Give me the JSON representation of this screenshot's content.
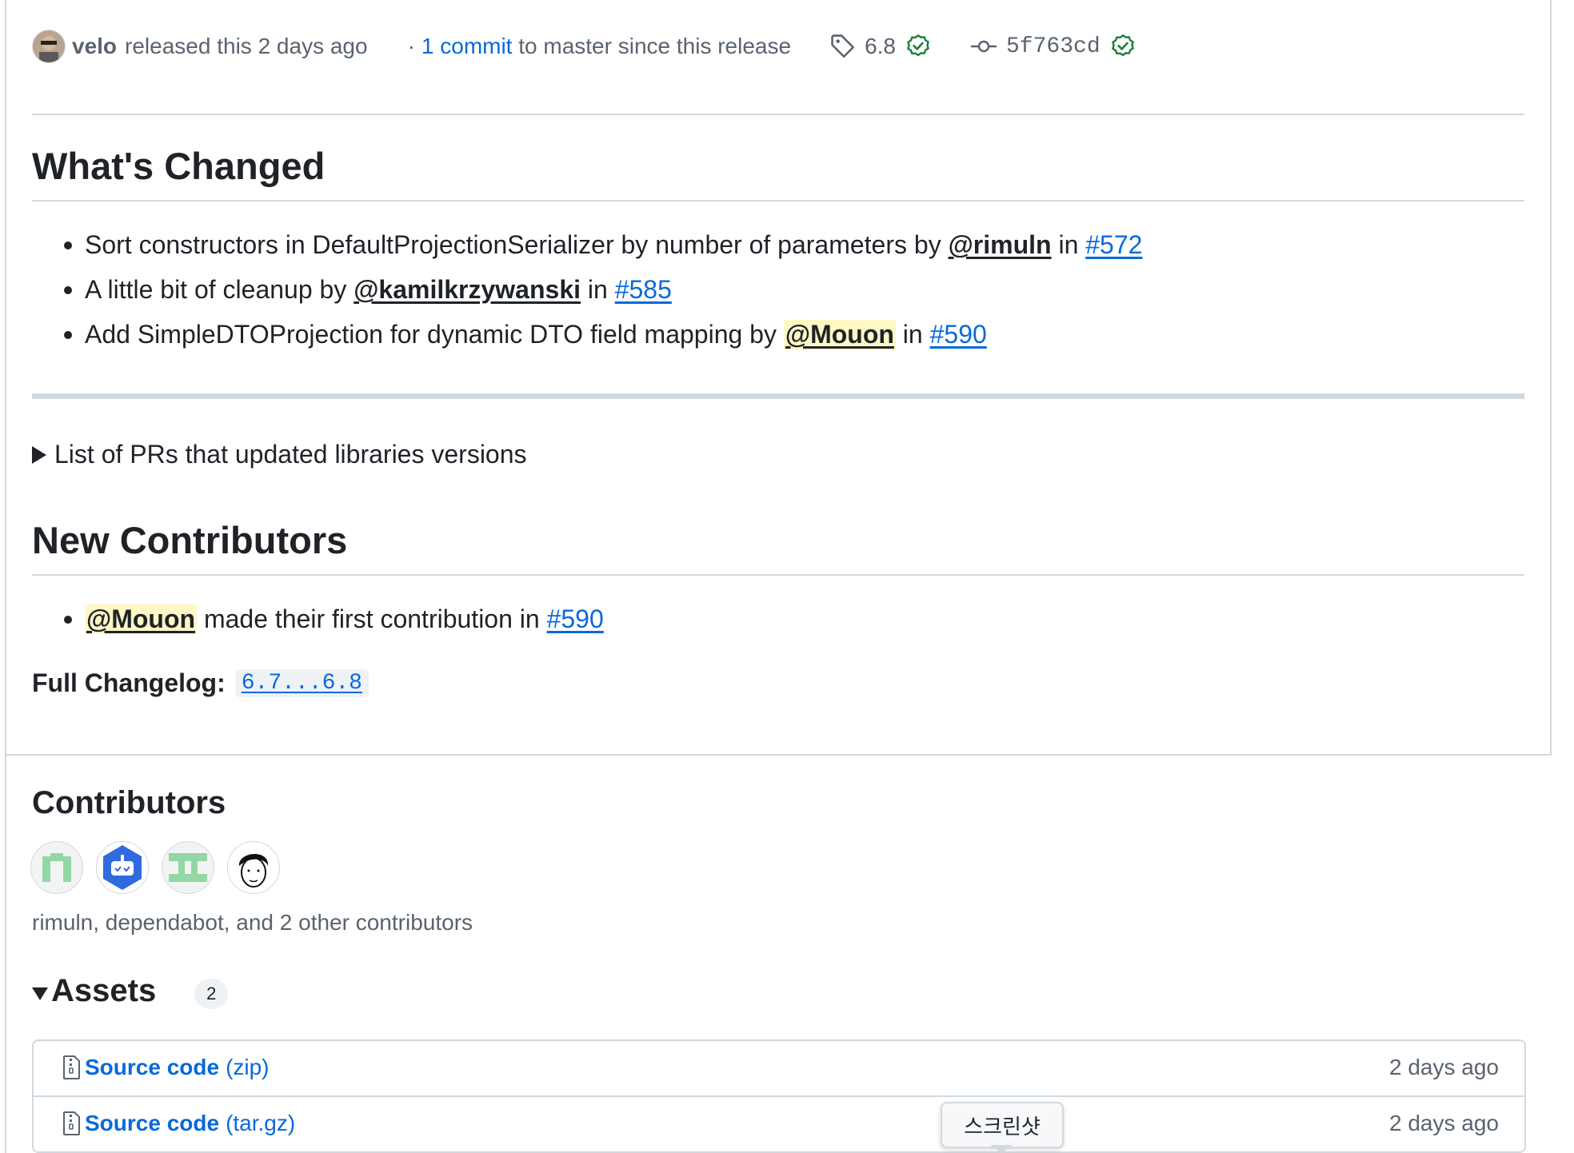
{
  "header": {
    "author": "velo",
    "released_text": "released this 2 days ago",
    "dot": "·",
    "commit_link": "1 commit",
    "commit_suffix": "to master since this release",
    "tag": "6.8",
    "commit_sha": "5f763cd"
  },
  "whats_changed": {
    "title": "What's Changed",
    "items": [
      {
        "text": "Sort constructors in DefaultProjectionSerializer by number of parameters by",
        "mention": "@rimuln",
        "in": "in",
        "pr": "#572"
      },
      {
        "text": "A little bit of cleanup by",
        "mention": "@kamilkrzywanski",
        "in": "in",
        "pr": "#585"
      },
      {
        "text": "Add SimpleDTOProjection for dynamic DTO field mapping by",
        "mention": "@Mouon",
        "in": "in",
        "pr": "#590"
      }
    ]
  },
  "details_summary": "List of PRs that updated libraries versions",
  "new_contributors": {
    "title": "New Contributors",
    "items": [
      {
        "mention": "@Mouon",
        "text": "made their first contribution in",
        "pr": "#590"
      }
    ]
  },
  "changelog": {
    "label": "Full Changelog:",
    "range": "6.7...6.8"
  },
  "contributors": {
    "title": "Contributors",
    "summary": "rimuln, dependabot, and 2 other contributors"
  },
  "assets": {
    "title": "Assets",
    "count": "2",
    "items": [
      {
        "name": "Source code",
        "ext": "(zip)",
        "date": "2 days ago"
      },
      {
        "name": "Source code",
        "ext": "(tar.gz)",
        "date": "2 days ago"
      }
    ]
  },
  "tooltip": "스크린샷",
  "colors": {
    "link": "#0969da",
    "verified": "#1a7f37",
    "mention_highlight": "#fff8c5"
  }
}
